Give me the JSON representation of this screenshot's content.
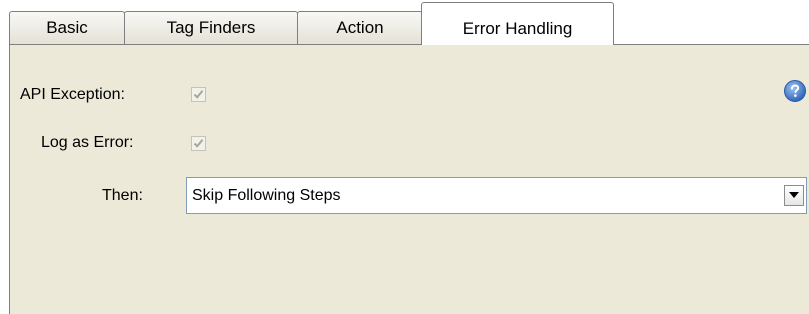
{
  "tabs": [
    {
      "label": "Basic",
      "active": false
    },
    {
      "label": "Tag Finders",
      "active": false
    },
    {
      "label": "Action",
      "active": false
    },
    {
      "label": "Error Handling",
      "active": true
    }
  ],
  "form": {
    "api_exception": {
      "label": "API Exception:",
      "checked": true,
      "disabled": true
    },
    "log_as_error": {
      "label": "Log as Error:",
      "checked": true,
      "disabled": true
    },
    "then": {
      "label": "Then:",
      "selected": "Skip Following Steps"
    }
  },
  "icons": {
    "help": "help-icon",
    "dropdown": "chevron-down-icon",
    "check": "checkmark-icon"
  },
  "colors": {
    "panel_bg": "#ece9d8",
    "help_blue": "#3a73c9",
    "select_border": "#7f9db9"
  }
}
